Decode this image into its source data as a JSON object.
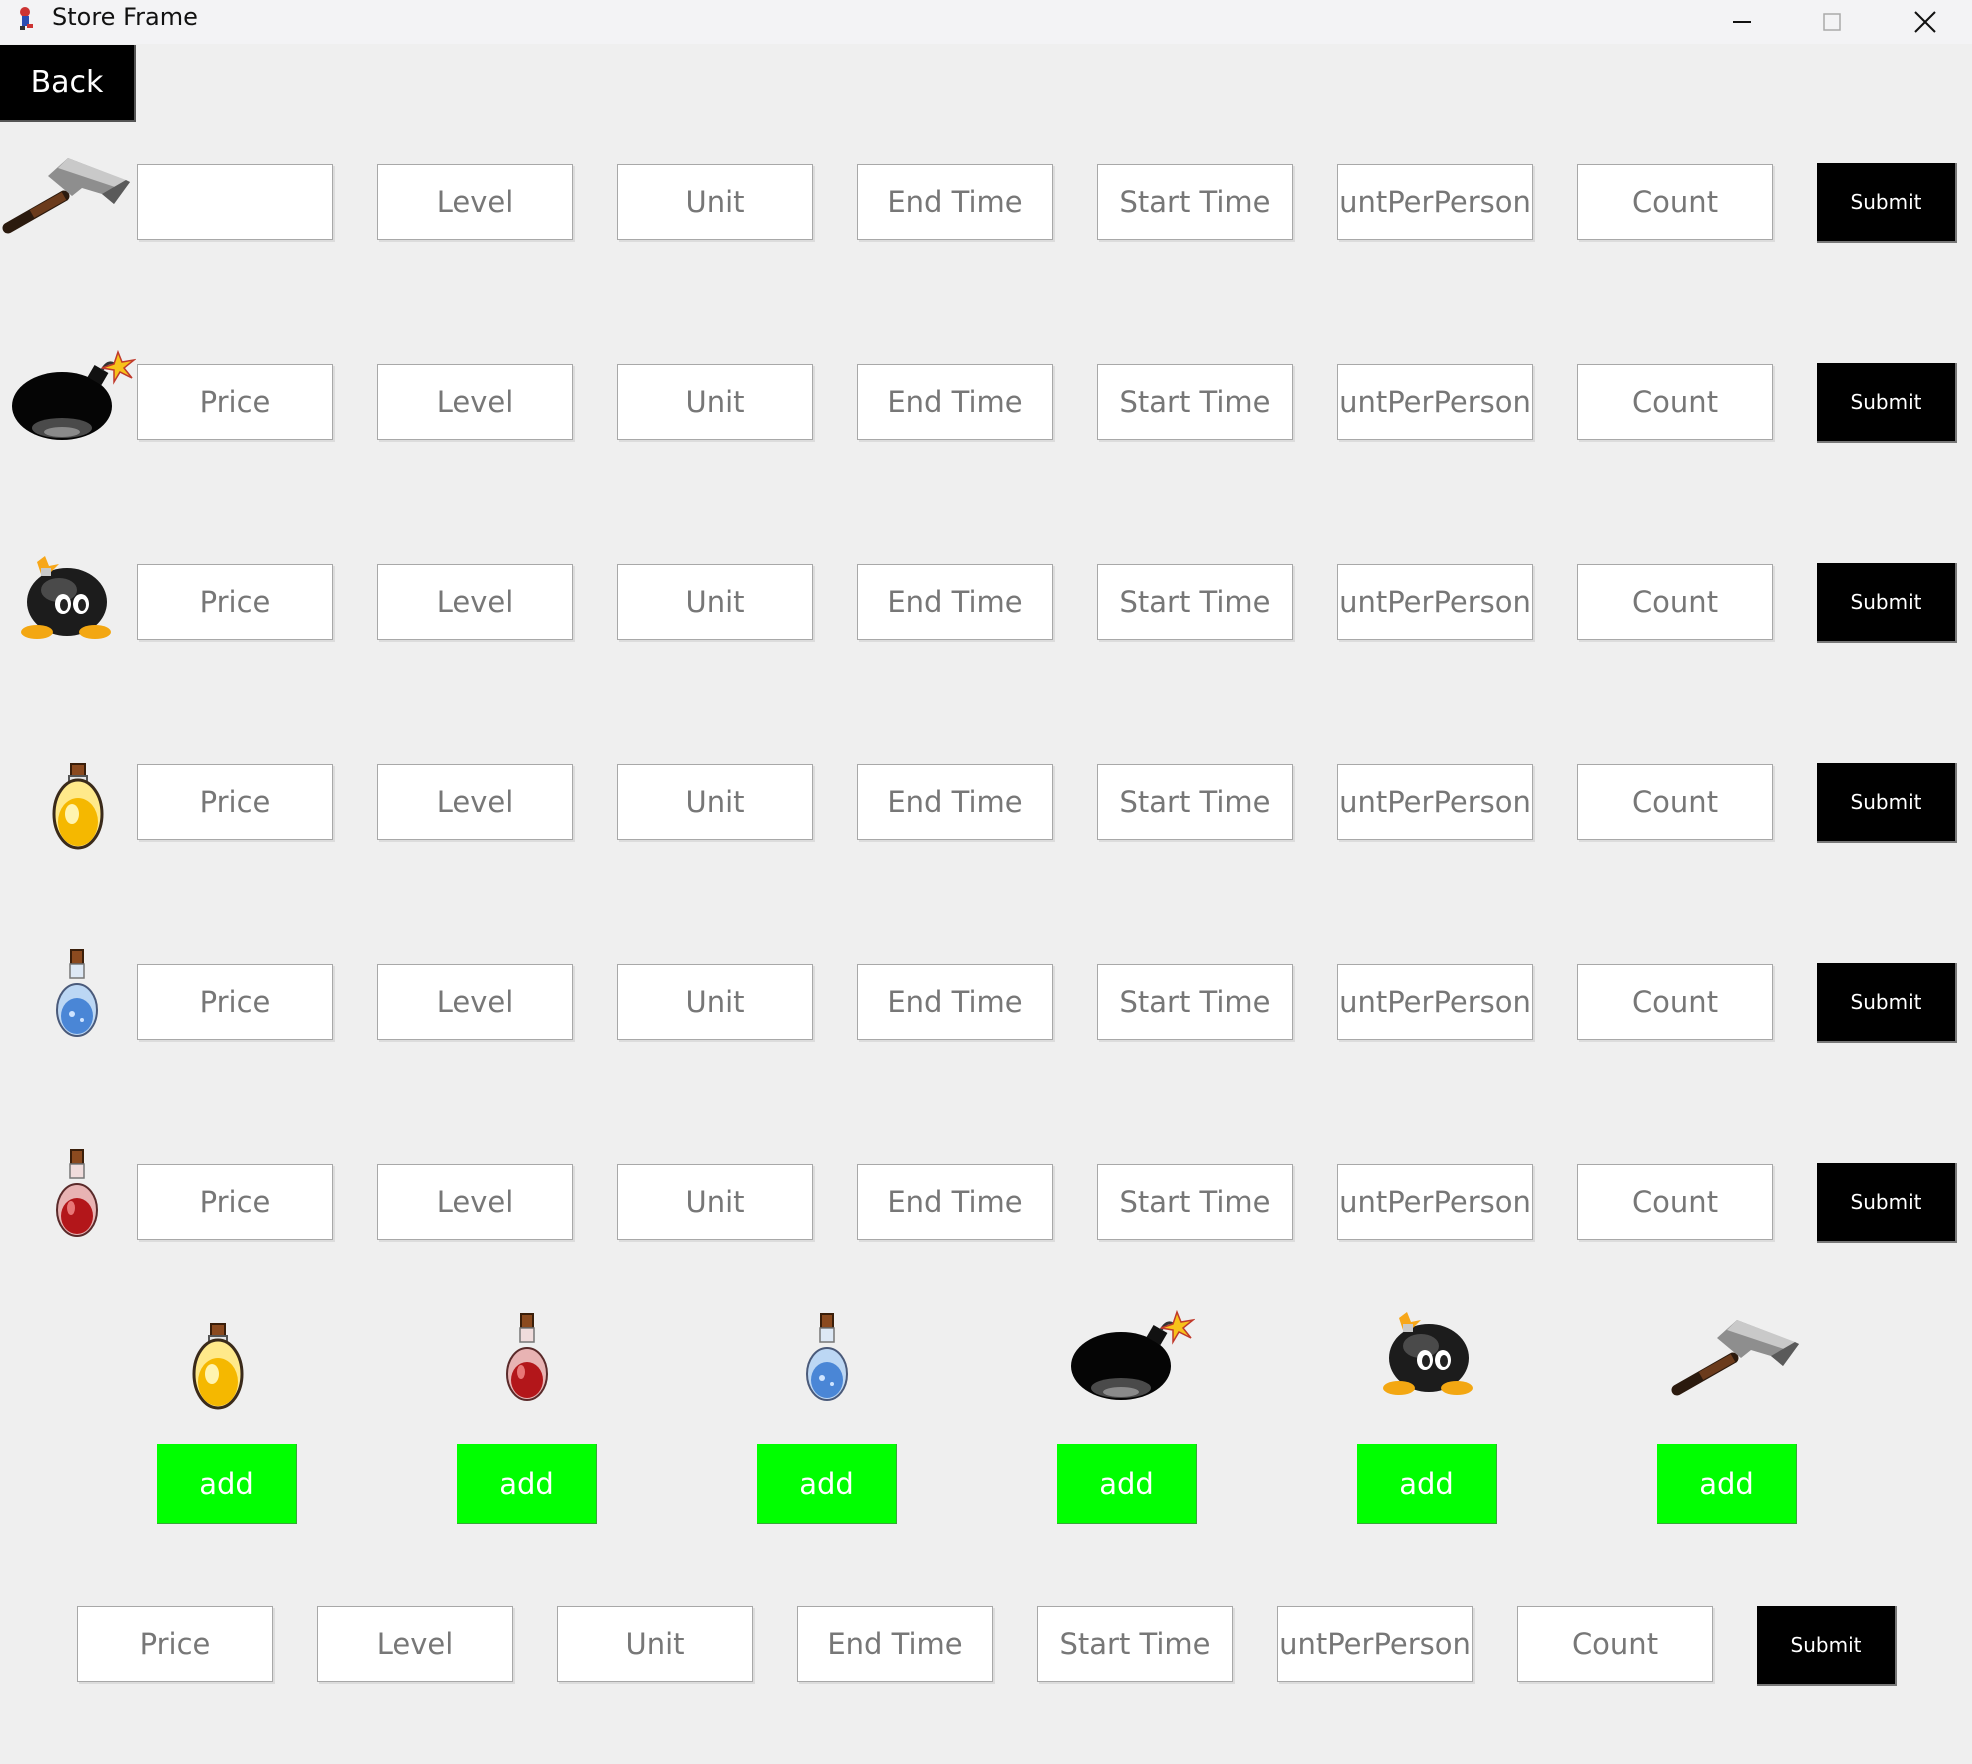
{
  "window": {
    "title": "Store Frame",
    "minimize_icon": "minimize-icon",
    "maximize_icon": "maximize-icon",
    "close_icon": "close-icon"
  },
  "back_label": "Back",
  "rows": [
    {
      "icon": "hammer-icon",
      "placeholders": [
        "",
        "Level",
        "Unit",
        "End Time",
        "Start Time",
        "untPerPerson",
        "Count"
      ],
      "submit": "Submit"
    },
    {
      "icon": "bomb-icon",
      "placeholders": [
        "Price",
        "Level",
        "Unit",
        "End Time",
        "Start Time",
        "untPerPerson",
        "Count"
      ],
      "submit": "Submit"
    },
    {
      "icon": "bob-omb-icon",
      "placeholders": [
        "Price",
        "Level",
        "Unit",
        "End Time",
        "Start Time",
        "untPerPerson",
        "Count"
      ],
      "submit": "Submit"
    },
    {
      "icon": "yellow-potion-icon",
      "placeholders": [
        "Price",
        "Level",
        "Unit",
        "End Time",
        "Start Time",
        "untPerPerson",
        "Count"
      ],
      "submit": "Submit"
    },
    {
      "icon": "blue-potion-icon",
      "placeholders": [
        "Price",
        "Level",
        "Unit",
        "End Time",
        "Start Time",
        "untPerPerson",
        "Count"
      ],
      "submit": "Submit"
    },
    {
      "icon": "red-potion-icon",
      "placeholders": [
        "Price",
        "Level",
        "Unit",
        "End Time",
        "Start Time",
        "untPerPerson",
        "Count"
      ],
      "submit": "Submit"
    }
  ],
  "add_items": [
    {
      "icon": "yellow-potion-icon",
      "label": "add"
    },
    {
      "icon": "red-potion-icon",
      "label": "add"
    },
    {
      "icon": "blue-potion-icon",
      "label": "add"
    },
    {
      "icon": "bomb-icon",
      "label": "add"
    },
    {
      "icon": "bob-omb-icon",
      "label": "add"
    },
    {
      "icon": "hammer-icon",
      "label": "add"
    }
  ],
  "bottom_row": {
    "placeholders": [
      "Price",
      "Level",
      "Unit",
      "End Time",
      "Start Time",
      "untPerPerson",
      "Count"
    ],
    "submit": "Submit"
  },
  "colors": {
    "background": "#efefef",
    "button": "#000000",
    "add_button": "#00ff00",
    "field_text": "#777777"
  }
}
